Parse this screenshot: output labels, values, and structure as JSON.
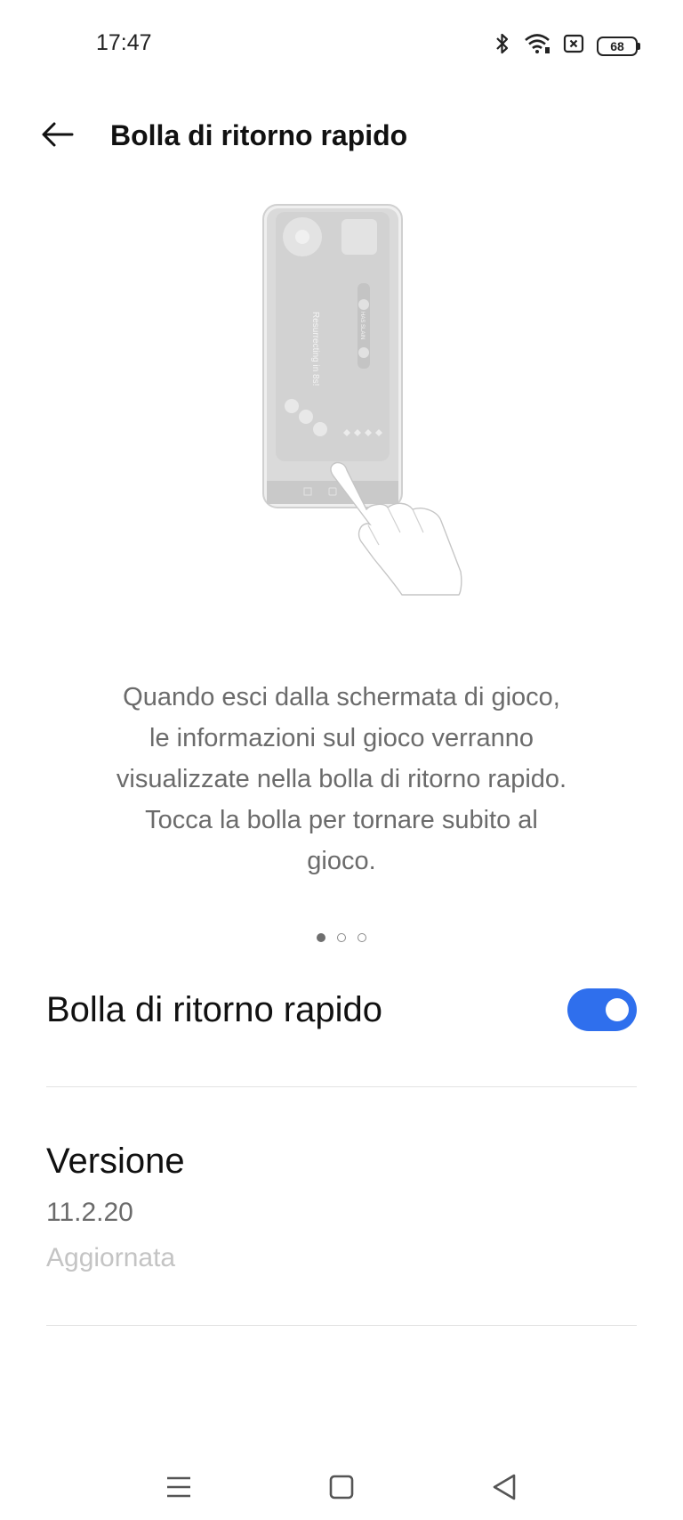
{
  "status_bar": {
    "time": "17:47",
    "battery": "68",
    "icons": [
      "bluetooth-icon",
      "wifi-icon",
      "sim-off-icon",
      "battery-icon"
    ]
  },
  "app_bar": {
    "back_icon": "arrow-left-icon",
    "title": "Bolla di ritorno rapido"
  },
  "illustration": {
    "rotated_text": "Resurrecting in 8s!",
    "side_text": "HAS SLAIN"
  },
  "description": {
    "lines": [
      "Quando esci dalla schermata di gioco,",
      "le informazioni sul gioco verranno",
      "visualizzate nella bolla di ritorno rapido.",
      "Tocca la bolla per tornare subito al",
      "gioco."
    ]
  },
  "pager": {
    "count": 3,
    "active_index": 0
  },
  "settings": {
    "bubble_toggle": {
      "label": "Bolla di ritorno rapido",
      "enabled": true
    },
    "version": {
      "title": "Versione",
      "number": "11.2.20",
      "status": "Aggiornata"
    }
  },
  "colors": {
    "accent": "#2f6fed",
    "description_text": "#6b6b6b",
    "muted_text": "#c4c4c4",
    "divider": "#e3e3e3"
  },
  "nav_bar": {
    "icons": [
      "menu-icon",
      "home-icon",
      "back-triangle-icon"
    ]
  }
}
